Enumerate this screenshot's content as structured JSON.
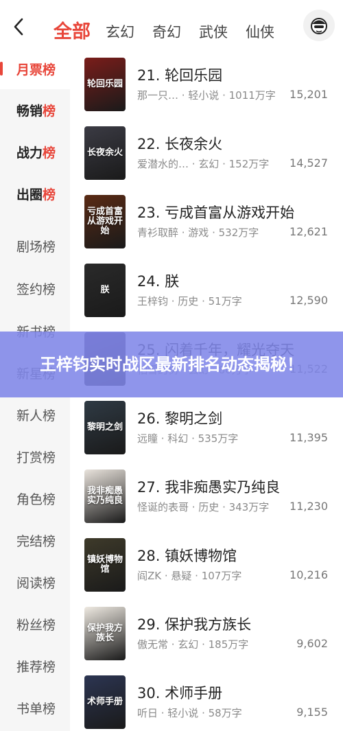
{
  "header": {
    "tabs": [
      "全部",
      "玄幻",
      "奇幻",
      "武侠",
      "仙侠"
    ],
    "active_tab": 0
  },
  "sidebar": {
    "items": [
      {
        "label_a": "月票",
        "label_b": "榜"
      },
      {
        "label_a": "畅销",
        "label_b": "榜"
      },
      {
        "label_a": "战力",
        "label_b": "榜"
      },
      {
        "label_a": "出圈",
        "label_b": "榜"
      },
      {
        "label_a": "剧场榜",
        "label_b": ""
      },
      {
        "label_a": "签约榜",
        "label_b": ""
      },
      {
        "label_a": "新书榜",
        "label_b": ""
      },
      {
        "label_a": "新星榜",
        "label_b": ""
      },
      {
        "label_a": "新人榜",
        "label_b": ""
      },
      {
        "label_a": "打赏榜",
        "label_b": ""
      },
      {
        "label_a": "角色榜",
        "label_b": ""
      },
      {
        "label_a": "完结榜",
        "label_b": ""
      },
      {
        "label_a": "阅读榜",
        "label_b": ""
      },
      {
        "label_a": "粉丝榜",
        "label_b": ""
      },
      {
        "label_a": "推荐榜",
        "label_b": ""
      },
      {
        "label_a": "书单榜",
        "label_b": ""
      }
    ]
  },
  "books": [
    {
      "title": "21. 轮回乐园",
      "meta": "那一只… · 轻小说 · 1011万字",
      "score": "15,201",
      "cover_text": "轮回乐园",
      "cover_color": "#7a1d1a"
    },
    {
      "title": "22. 长夜余火",
      "meta": "爱潜水的… · 玄幻 · 152万字",
      "score": "14,527",
      "cover_text": "长夜余火",
      "cover_color": "#3b3b44"
    },
    {
      "title": "23. 亏成首富从游戏开始",
      "meta": "青衫取醉 · 游戏 · 532万字",
      "score": "12,621",
      "cover_text": "亏成首富从游戏开始",
      "cover_color": "#5a2a14"
    },
    {
      "title": "24. 朕",
      "meta": "王梓钧 · 历史 · 51万字",
      "score": "12,590",
      "cover_text": "朕",
      "cover_color": "#2a2a2a"
    },
    {
      "title": "25. 闪着千年，耀光夺天",
      "meta": "怕雪的树 · 玄幻 · 80万字",
      "score": "11,522",
      "cover_text": "",
      "cover_color": "#4a3a6a"
    },
    {
      "title": "26. 黎明之剑",
      "meta": "远瞳 · 科幻 · 535万字",
      "score": "11,395",
      "cover_text": "黎明之剑",
      "cover_color": "#2f3a44"
    },
    {
      "title": "27. 我非痴愚实乃纯良",
      "meta": "怪诞的表哥 · 历史 · 343万字",
      "score": "11,230",
      "cover_text": "我非痴愚 实乃纯良",
      "cover_color": "#e9e3dc"
    },
    {
      "title": "28. 镇妖博物馆",
      "meta": "阎ZK · 悬疑 · 107万字",
      "score": "10,216",
      "cover_text": "镇妖博物馆",
      "cover_color": "#3e3a2a"
    },
    {
      "title": "29. 保护我方族长",
      "meta": "傲无常 · 玄幻 · 185万字",
      "score": "9,602",
      "cover_text": "保护我方族长",
      "cover_color": "#efeae2"
    },
    {
      "title": "30. 术师手册",
      "meta": "听日 · 轻小说 · 58万字",
      "score": "9,155",
      "cover_text": "术师手册",
      "cover_color": "#2c3552"
    }
  ],
  "banner": {
    "text": "王梓钧实时战区最新排名动态揭秘！"
  },
  "colors": {
    "accent": "#e8463a",
    "banner": "#8086e8"
  }
}
